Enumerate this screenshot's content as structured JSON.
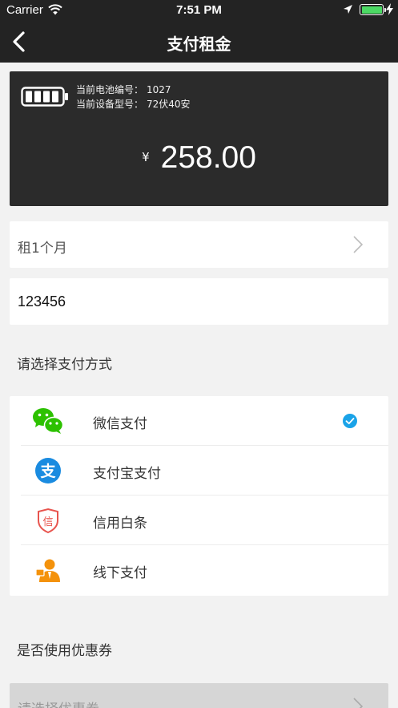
{
  "status_bar": {
    "carrier": "Carrier",
    "time": "7:51 PM"
  },
  "nav": {
    "title": "支付租金",
    "back_icon": "chevron-left-icon"
  },
  "battery_card": {
    "battery_number_label": "当前电池编号：",
    "battery_number": "1027",
    "device_model_label": "当前设备型号：",
    "device_model": "72伏40安",
    "currency": "¥",
    "amount": "258.00"
  },
  "rent_plan": {
    "label": "租1个月"
  },
  "code_input": {
    "value": "123456"
  },
  "payment": {
    "section_title": "请选择支付方式",
    "methods": [
      {
        "label": "微信支付",
        "icon": "wechat-icon",
        "selected": true
      },
      {
        "label": "支付宝支付",
        "icon": "alipay-icon",
        "selected": false
      },
      {
        "label": "信用白条",
        "icon": "credit-shield-icon",
        "selected": false
      },
      {
        "label": "线下支付",
        "icon": "offline-person-icon",
        "selected": false
      }
    ]
  },
  "coupon": {
    "section_title": "是否使用优惠券",
    "placeholder": "请选择优惠券"
  },
  "colors": {
    "bar_background": "#232323",
    "card_background": "#2b2b2b",
    "page_background": "#f2f2f2",
    "check_blue": "#1aa3e8",
    "wechat_green": "#2dc100",
    "alipay_blue": "#1a8be0",
    "credit_red": "#e8544e",
    "offline_orange": "#f4920b"
  }
}
